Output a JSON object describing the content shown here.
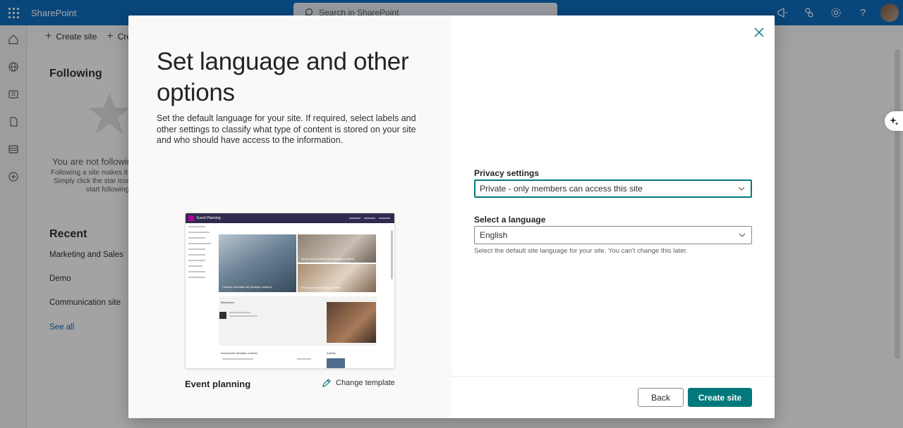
{
  "app": {
    "brand": "SharePoint",
    "search_placeholder": "Search in SharePoint"
  },
  "cmdbar": {
    "create_site": "Create site",
    "create_news": "Cre"
  },
  "background": {
    "following_heading": "Following",
    "not_following": "You are not followin",
    "following_desc_1": "Following a site makes it e",
    "following_desc_2": "Simply click the star icon",
    "following_desc_3": "start following",
    "recent_heading": "Recent",
    "recent_items": [
      "Marketing and Sales",
      "Demo",
      "Communication site"
    ],
    "see_all": "See all"
  },
  "modal": {
    "title": "Set language and other options",
    "description": "Set the default language for your site. If required, select labels and other settings to classify what type of content is stored on your site and who should have access to the information.",
    "template_name": "Event planning",
    "change_template": "Change template",
    "preview": {
      "site_title": "Event Planning",
      "caption_a": "Content scheduler list (Sample content)",
      "caption_b": "About Our Content team (Sample content)",
      "caption_c": "Preview event (Sample content)",
      "milestones": "Milestones",
      "documents": "Documents (Sample content)",
      "activity": "Activity"
    },
    "privacy": {
      "label": "Privacy settings",
      "value": "Private - only members can access this site"
    },
    "language": {
      "label": "Select a language",
      "value": "English",
      "hint": "Select the default site language for your site. You can't change this later."
    },
    "buttons": {
      "back": "Back",
      "create": "Create site"
    }
  },
  "colors": {
    "topbar": "#0f6cbd",
    "accent": "#03787c"
  }
}
